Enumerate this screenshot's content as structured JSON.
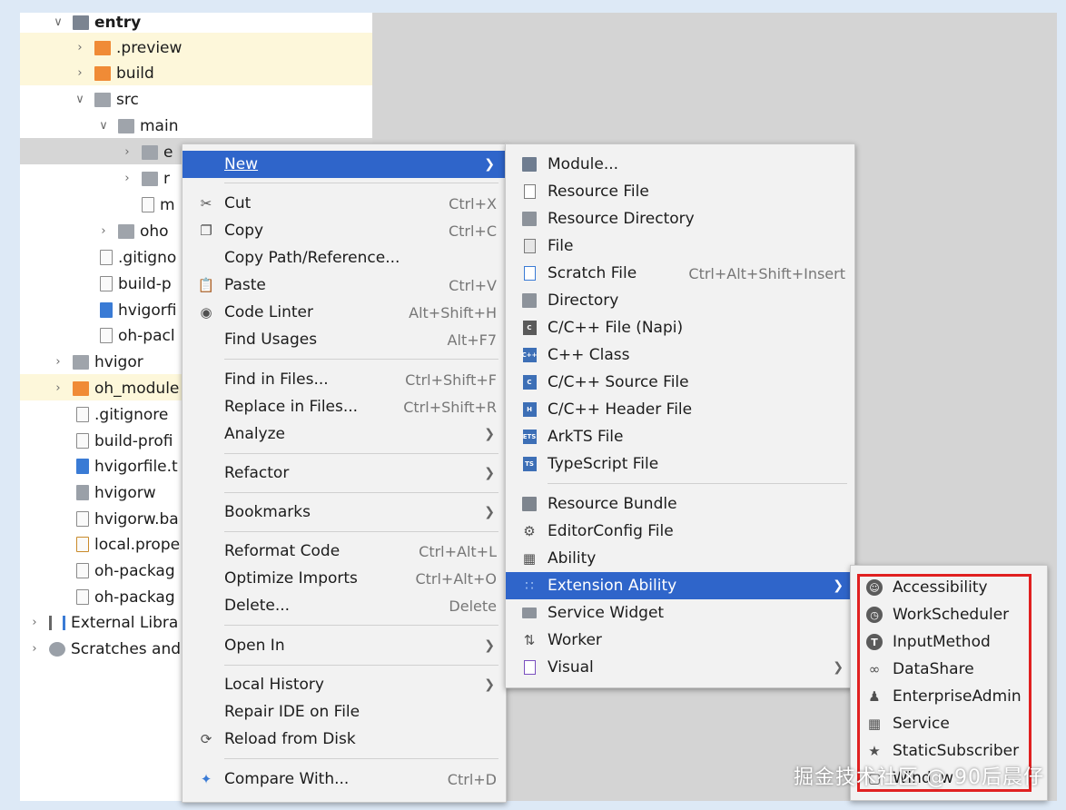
{
  "tree": {
    "items": [
      {
        "label": "entry",
        "arrow": "v",
        "icon": "folder-module-icon"
      },
      {
        "label": ".preview",
        "arrow": ">",
        "icon": "folder-orange-icon"
      },
      {
        "label": "build",
        "arrow": ">",
        "icon": "folder-orange-icon"
      },
      {
        "label": "src",
        "arrow": "v",
        "icon": "folder-icon"
      },
      {
        "label": "main",
        "arrow": "v",
        "icon": "folder-icon"
      },
      {
        "label": "e",
        "arrow": ">",
        "icon": "folder-icon"
      },
      {
        "label": "r",
        "arrow": ">",
        "icon": "folder-icon"
      },
      {
        "label": "m",
        "arrow": "",
        "icon": "json-file-icon"
      },
      {
        "label": "oho",
        "arrow": ">",
        "icon": "folder-icon"
      },
      {
        "label": ".gitigno",
        "arrow": "",
        "icon": "gitignore-file-icon"
      },
      {
        "label": "build-p",
        "arrow": "",
        "icon": "json-file-icon"
      },
      {
        "label": "hvigorfi",
        "arrow": "",
        "icon": "ts-file-icon"
      },
      {
        "label": "oh-pacl",
        "arrow": "",
        "icon": "json-file-icon"
      },
      {
        "label": "hvigor",
        "arrow": ">",
        "icon": "folder-icon"
      },
      {
        "label": "oh_module",
        "arrow": ">",
        "icon": "folder-orange-icon"
      },
      {
        "label": ".gitignore",
        "arrow": "",
        "icon": "gitignore-file-icon"
      },
      {
        "label": "build-profi",
        "arrow": "",
        "icon": "json-file-icon"
      },
      {
        "label": "hvigorfile.t",
        "arrow": "",
        "icon": "ts-file-icon"
      },
      {
        "label": "hvigorw",
        "arrow": "",
        "icon": "script-file-icon"
      },
      {
        "label": "hvigorw.ba",
        "arrow": "",
        "icon": "text-file-icon"
      },
      {
        "label": "local.prope",
        "arrow": "",
        "icon": "properties-file-icon"
      },
      {
        "label": "oh-packag",
        "arrow": "",
        "icon": "json-file-icon"
      },
      {
        "label": "oh-packag",
        "arrow": "",
        "icon": "json-file-icon"
      },
      {
        "label": "External Libra",
        "arrow": ">",
        "icon": "library-icon"
      },
      {
        "label": "Scratches and",
        "arrow": ">",
        "icon": "scratches-icon"
      }
    ]
  },
  "context_menu": {
    "items": [
      {
        "label": "New",
        "shortcut": "",
        "submenu": true,
        "selected": true
      },
      {
        "label": "Cut",
        "shortcut": "Ctrl+X"
      },
      {
        "label": "Copy",
        "shortcut": "Ctrl+C"
      },
      {
        "label": "Copy Path/Reference...",
        "shortcut": ""
      },
      {
        "label": "Paste",
        "shortcut": "Ctrl+V"
      },
      {
        "label": "Code Linter",
        "shortcut": "Alt+Shift+H"
      },
      {
        "label": "Find Usages",
        "shortcut": "Alt+F7"
      },
      {
        "label": "Find in Files...",
        "shortcut": "Ctrl+Shift+F"
      },
      {
        "label": "Replace in Files...",
        "shortcut": "Ctrl+Shift+R"
      },
      {
        "label": "Analyze",
        "shortcut": ""
      },
      {
        "label": "Refactor",
        "shortcut": ""
      },
      {
        "label": "Bookmarks",
        "shortcut": ""
      },
      {
        "label": "Reformat Code",
        "shortcut": "Ctrl+Alt+L"
      },
      {
        "label": "Optimize Imports",
        "shortcut": "Ctrl+Alt+O"
      },
      {
        "label": "Delete...",
        "shortcut": "Delete"
      },
      {
        "label": "Open In",
        "shortcut": ""
      },
      {
        "label": "Local History",
        "shortcut": ""
      },
      {
        "label": "Repair IDE on File",
        "shortcut": ""
      },
      {
        "label": "Reload from Disk",
        "shortcut": ""
      },
      {
        "label": "Compare With...",
        "shortcut": "Ctrl+D"
      }
    ]
  },
  "new_submenu": {
    "items": [
      {
        "label": "Module...",
        "shortcut": ""
      },
      {
        "label": "Resource File",
        "shortcut": ""
      },
      {
        "label": "Resource Directory",
        "shortcut": ""
      },
      {
        "label": "File",
        "shortcut": ""
      },
      {
        "label": "Scratch File",
        "shortcut": "Ctrl+Alt+Shift+Insert"
      },
      {
        "label": "Directory",
        "shortcut": ""
      },
      {
        "label": "C/C++ File (Napi)",
        "shortcut": ""
      },
      {
        "label": "C++ Class",
        "shortcut": ""
      },
      {
        "label": "C/C++ Source File",
        "shortcut": ""
      },
      {
        "label": "C/C++ Header File",
        "shortcut": ""
      },
      {
        "label": "ArkTS File",
        "shortcut": ""
      },
      {
        "label": "TypeScript File",
        "shortcut": ""
      },
      {
        "label": "Resource Bundle",
        "shortcut": ""
      },
      {
        "label": "EditorConfig File",
        "shortcut": ""
      },
      {
        "label": "Ability",
        "shortcut": ""
      },
      {
        "label": "Extension Ability",
        "shortcut": "",
        "selected": true
      },
      {
        "label": "Service Widget",
        "shortcut": ""
      },
      {
        "label": "Worker",
        "shortcut": ""
      },
      {
        "label": "Visual",
        "shortcut": ""
      }
    ]
  },
  "extension_submenu": {
    "items": [
      {
        "label": "Accessibility"
      },
      {
        "label": "WorkScheduler"
      },
      {
        "label": "InputMethod"
      },
      {
        "label": "DataShare"
      },
      {
        "label": "EnterpriseAdmin"
      },
      {
        "label": "Service"
      },
      {
        "label": "StaticSubscriber"
      },
      {
        "label": "Window"
      }
    ]
  },
  "watermark": "掘金技术社区 @ 90后晨仔",
  "colors": {
    "selection": "#2f65ca",
    "highlight_box": "#e02020"
  }
}
